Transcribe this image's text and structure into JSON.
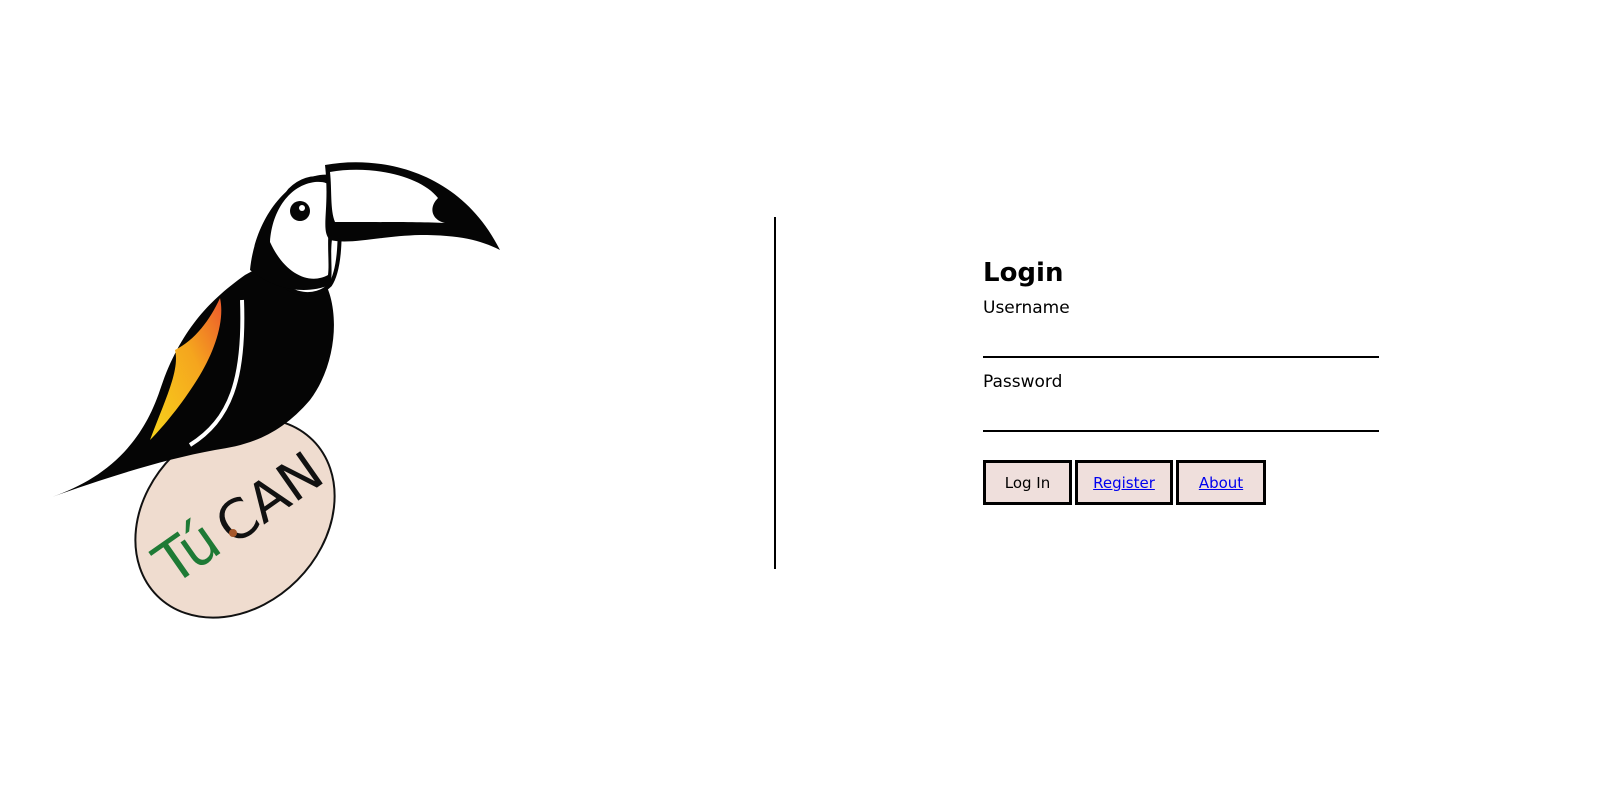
{
  "logo": {
    "icon": "toucan-logo-icon",
    "brand_text_green": "Tú",
    "brand_text_black": "CAN"
  },
  "login": {
    "title": "Login",
    "username_label": "Username",
    "username_value": "",
    "password_label": "Password",
    "password_value": "",
    "buttons": {
      "login": "Log In",
      "register": "Register",
      "about": "About"
    }
  },
  "colors": {
    "button_bg": "#efdfdc",
    "link": "#0000ee",
    "egg_fill": "#efdccf",
    "brand_green": "#1e7a35",
    "beak_dark": "#050505"
  }
}
